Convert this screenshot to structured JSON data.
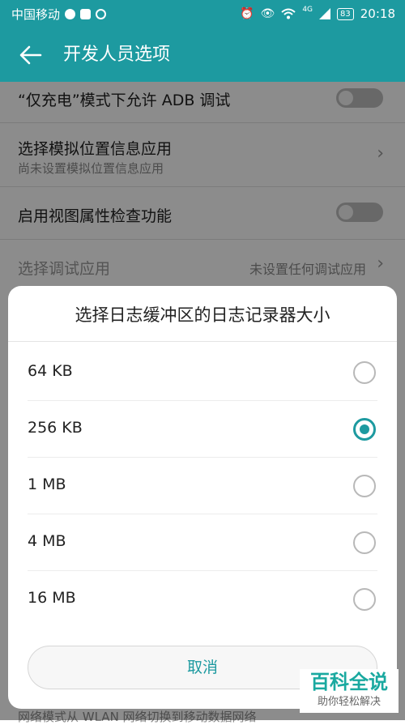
{
  "status_bar": {
    "carrier": "中国移动",
    "time": "20:18",
    "battery": "83",
    "net_label": "4G"
  },
  "app_bar": {
    "title": "开发人员选项"
  },
  "settings": [
    {
      "title": "“仅充电”模式下允许 ADB 调试",
      "type": "toggle"
    },
    {
      "title": "选择模拟位置信息应用",
      "subtitle": "尚未设置模拟位置信息应用",
      "type": "chevron"
    },
    {
      "title": "启用视图属性检查功能",
      "type": "toggle"
    },
    {
      "title": "选择调试应用",
      "value": "未设置任何调试应用",
      "type": "chevron"
    }
  ],
  "dialog": {
    "title": "选择日志缓冲区的日志记录器大小",
    "options": [
      {
        "label": "64 KB",
        "selected": false
      },
      {
        "label": "256 KB",
        "selected": true
      },
      {
        "label": "1 MB",
        "selected": false
      },
      {
        "label": "4 MB",
        "selected": false
      },
      {
        "label": "16 MB",
        "selected": false
      }
    ],
    "cancel_label": "取消"
  },
  "bottom_text": "网络模式从 WLAN 网络切换到移动数据网络",
  "watermark": {
    "main": "百科全说",
    "sub": "助你轻松解决"
  },
  "colors": {
    "accent": "#1d9aa0"
  }
}
